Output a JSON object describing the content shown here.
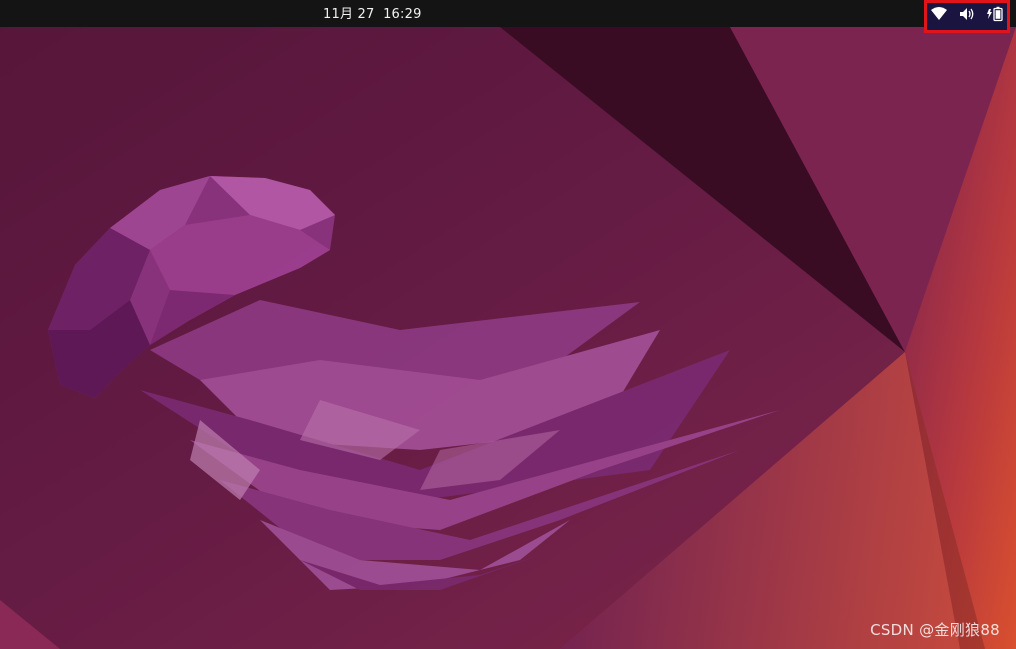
{
  "top_bar": {
    "clock": "11月 27  16:29"
  },
  "system_tray": {
    "icons": [
      "network-wireless-icon",
      "volume-icon",
      "battery-charging-icon"
    ],
    "highlight_color": "#e0151c"
  },
  "desktop": {
    "wallpaper": "jammy-jellyfish-wallpaper",
    "colors": {
      "primary": "#6a1f4a",
      "accent": "#c4463a",
      "jellyfish": "#8e3a84"
    }
  },
  "watermark": {
    "text": "CSDN @金刚狼88"
  }
}
